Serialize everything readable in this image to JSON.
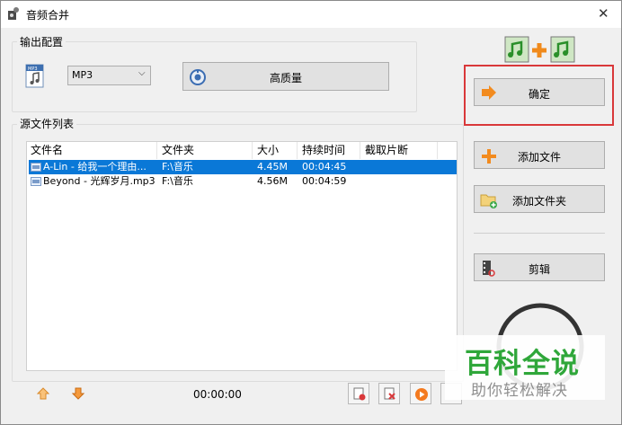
{
  "window": {
    "title": "音频合并"
  },
  "output_config": {
    "group_label": "输出配置",
    "format_value": "MP3",
    "quality_label": "高质量"
  },
  "source_list": {
    "group_label": "源文件列表",
    "columns": [
      "文件名",
      "文件夹",
      "大小",
      "持续时间",
      "截取片断"
    ],
    "rows": [
      {
        "name": "A-Lin - 给我一个理由...",
        "folder": "F:\\音乐",
        "size": "4.45M",
        "duration": "00:04:45",
        "clip": "",
        "selected": true
      },
      {
        "name": "Beyond - 光辉岁月.mp3",
        "folder": "F:\\音乐",
        "size": "4.56M",
        "duration": "00:04:59",
        "clip": "",
        "selected": false
      }
    ],
    "time_display": "00:00:00"
  },
  "actions": {
    "confirm_label": "确定",
    "add_file_label": "添加文件",
    "add_folder_label": "添加文件夹",
    "clip_label": "剪辑"
  },
  "watermark": {
    "brand": "百科全说",
    "slogan": "助你轻松解决"
  },
  "colors": {
    "selection": "#0a78d7",
    "highlight_border": "#d9383a",
    "watermark_green": "#2fa73a"
  }
}
